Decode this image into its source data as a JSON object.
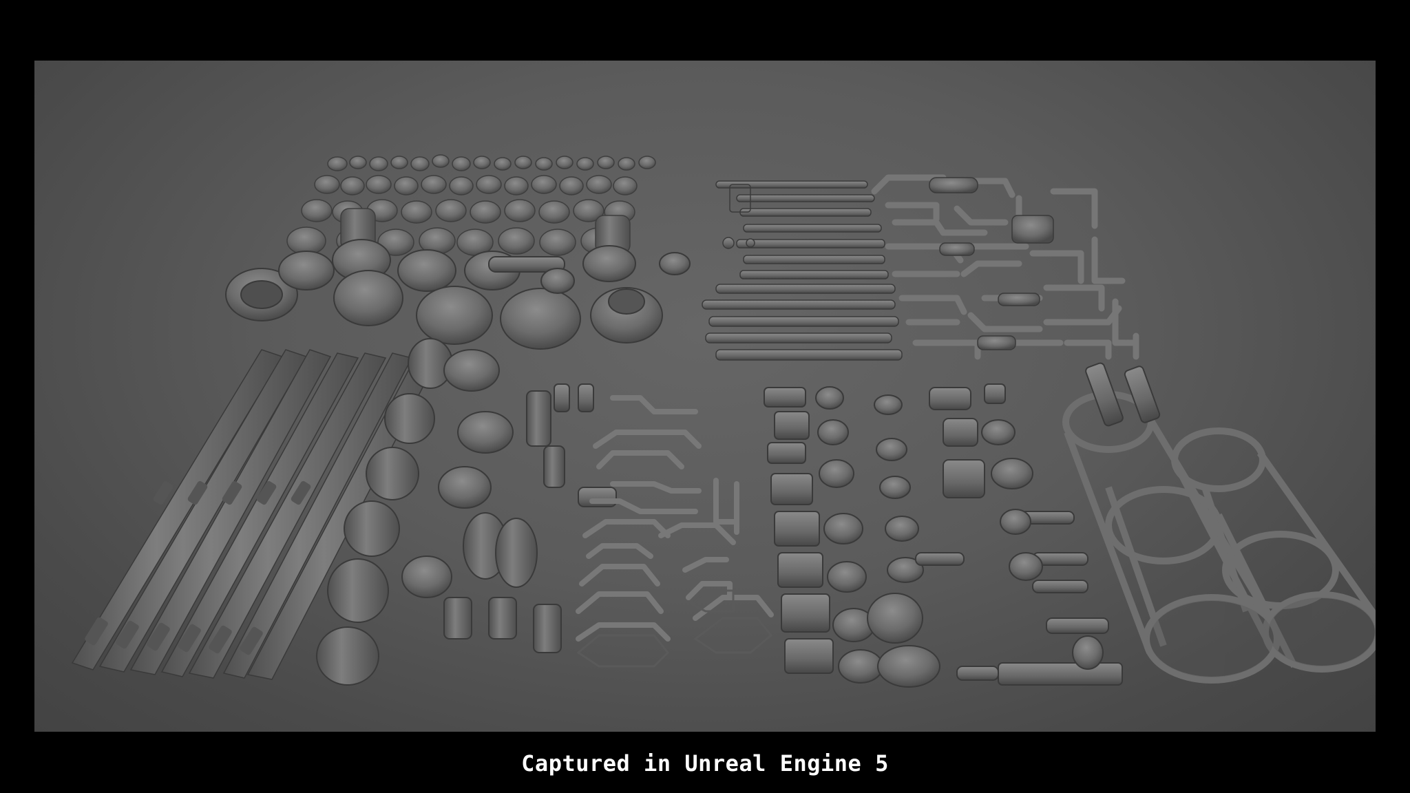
{
  "caption": {
    "text": "Captured in Unreal Engine 5"
  },
  "scene": {
    "background_color": "#5e5e5e",
    "frame_color": "#000000",
    "part_color": "#6f6f6f",
    "part_shadow_color": "#3a3a3a"
  }
}
